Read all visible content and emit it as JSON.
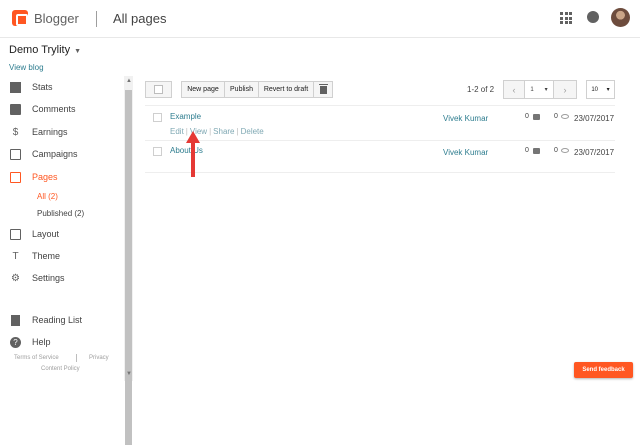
{
  "header": {
    "brand": "Blogger",
    "page_title": "All pages"
  },
  "sidebar": {
    "blog_name": "Demo Trylity",
    "view_blog": "View blog",
    "items": [
      {
        "label": "Stats",
        "icon": "stats-icon"
      },
      {
        "label": "Comments",
        "icon": "comment-icon"
      },
      {
        "label": "Earnings",
        "icon": "dollar-icon"
      },
      {
        "label": "Campaigns",
        "icon": "campaign-icon"
      },
      {
        "label": "Pages",
        "icon": "pages-icon",
        "active": true
      },
      {
        "label": "Layout",
        "icon": "layout-icon"
      },
      {
        "label": "Theme",
        "icon": "theme-icon"
      },
      {
        "label": "Settings",
        "icon": "gear-icon"
      },
      {
        "label": "Reading List",
        "icon": "bookmark-icon"
      },
      {
        "label": "Help",
        "icon": "help-icon"
      }
    ],
    "sub_items": [
      {
        "label": "All (2)",
        "active": true
      },
      {
        "label": "Published (2)"
      }
    ],
    "footer": {
      "terms": "Terms of Service",
      "privacy": "Privacy",
      "content_policy": "Content Policy"
    }
  },
  "toolbar": {
    "new_page": "New page",
    "publish": "Publish",
    "revert": "Revert to draft",
    "page_info": "1-2 of 2",
    "page_select": "1",
    "per_page": "10"
  },
  "pages": [
    {
      "title": "Example",
      "author": "Vivek Kumar",
      "comments": "0",
      "views": "0",
      "date": "23/07/2017",
      "actions": [
        "Edit",
        "View",
        "Share",
        "Delete"
      ]
    },
    {
      "title": "About Us",
      "author": "Vivek Kumar",
      "comments": "0",
      "views": "0",
      "date": "23/07/2017"
    }
  ],
  "feedback": "Send feedback",
  "colors": {
    "accent": "#ff5722",
    "link": "#2e7d8f",
    "annotation_arrow": "#e53935"
  }
}
